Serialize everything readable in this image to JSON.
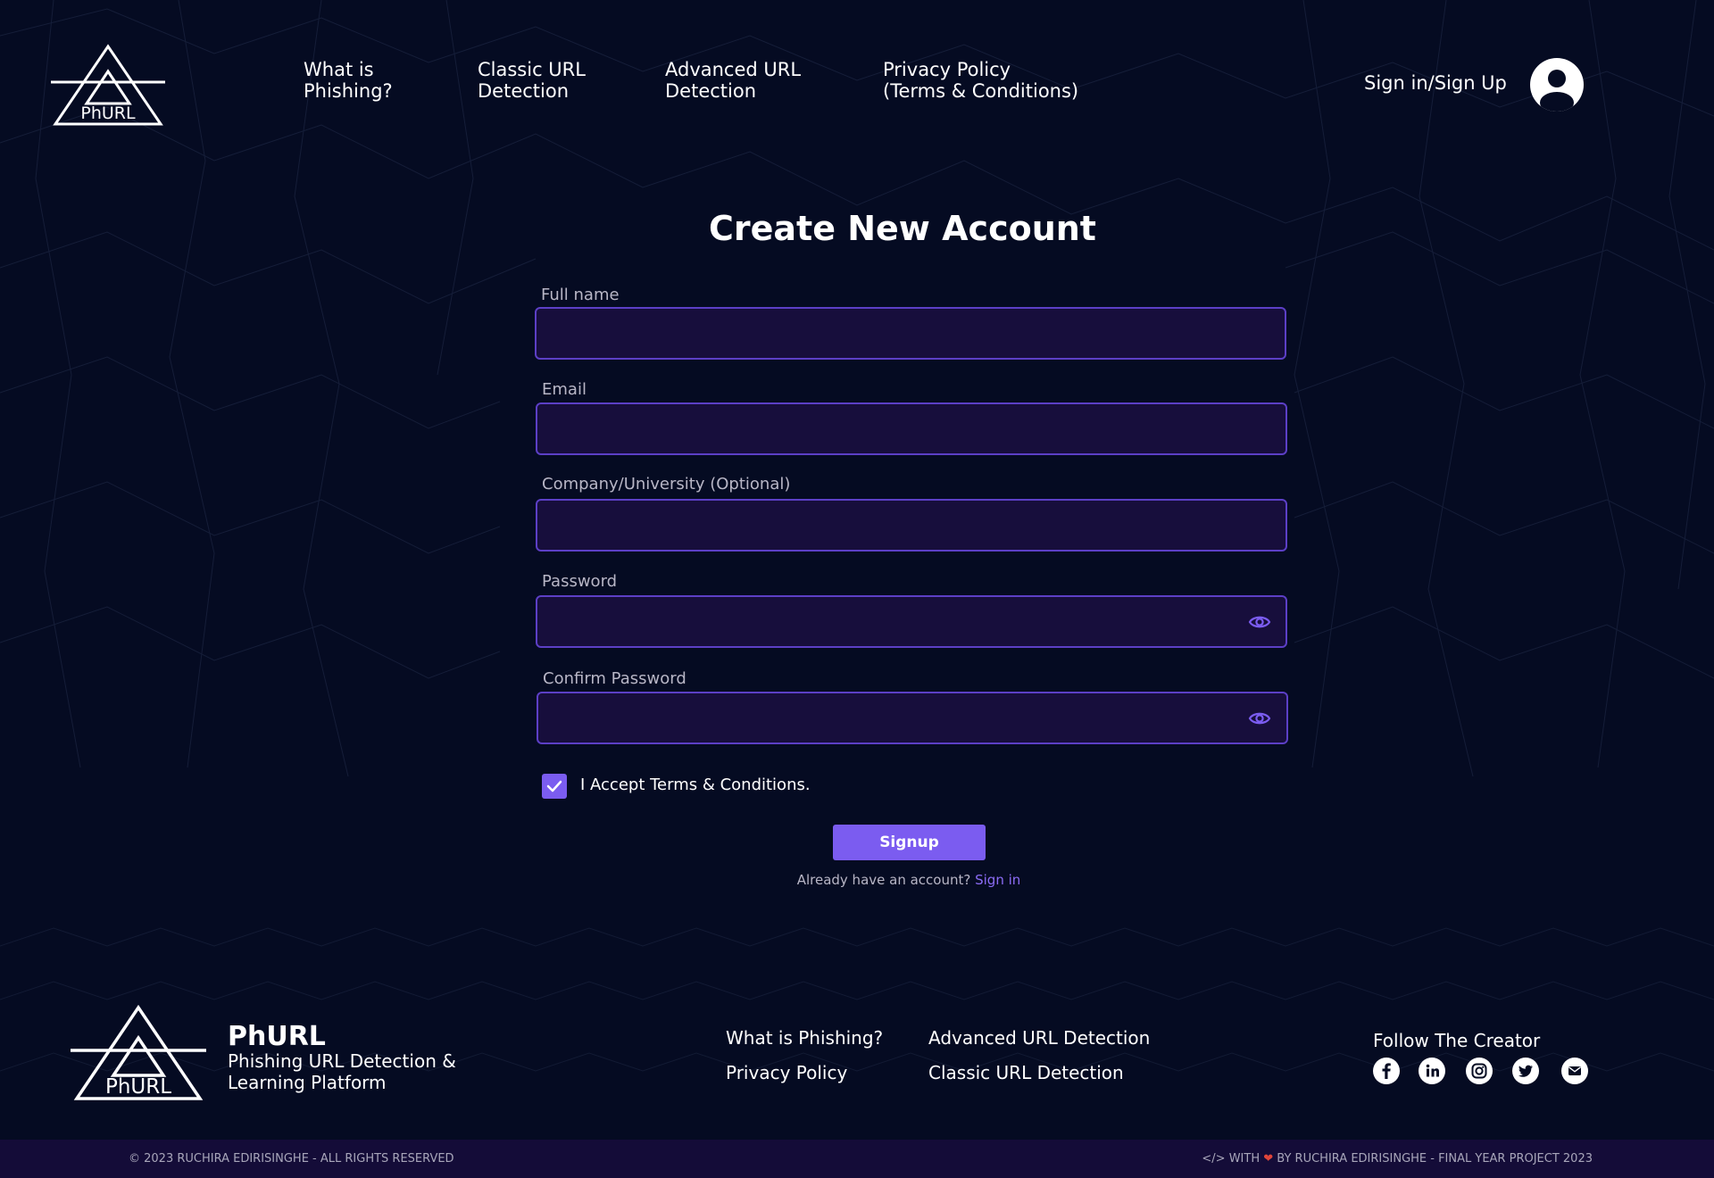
{
  "brand": {
    "logo_text": "PhURL",
    "name": "PhURL",
    "tagline": "Phishing URL Detection &\nLearning Platform"
  },
  "nav": {
    "items": [
      {
        "label": "What is\nPhishing?"
      },
      {
        "label": "Classic URL\nDetection"
      },
      {
        "label": "Advanced URL\nDetection"
      },
      {
        "label": "Privacy Policy\n(Terms & Conditions)"
      }
    ],
    "signin_label": "Sign in/Sign Up",
    "avatar_icon": "user-circle-icon"
  },
  "form": {
    "title": "Create New Account",
    "fields": [
      {
        "label": "Full name",
        "value": "",
        "placeholder": ""
      },
      {
        "label": "Email",
        "value": "",
        "placeholder": ""
      },
      {
        "label": "Company/University (Optional)",
        "value": "",
        "placeholder": ""
      },
      {
        "label": "Password",
        "value": "",
        "placeholder": "",
        "icon": "eye-icon"
      },
      {
        "label": "Confirm Password",
        "value": "",
        "placeholder": "",
        "icon": "eye-icon"
      }
    ],
    "terms_checked": true,
    "terms_label": "I Accept Terms & Conditions.",
    "submit_label": "Signup",
    "already_text": "Already have an account?",
    "signin_link": "Sign in"
  },
  "footer": {
    "links": [
      "What is Phishing?",
      "Advanced URL Detection",
      "Privacy Policy",
      "Classic URL Detection"
    ],
    "follow_title": "Follow The Creator",
    "socials": [
      "facebook-icon",
      "linkedin-icon",
      "instagram-icon",
      "twitter-icon",
      "mail-icon"
    ],
    "copyright": "© 2023 RUCHIRA EDIRISINGHE - ALL RIGHTS RESERVED",
    "credit_prefix": "</> WITH",
    "credit_suffix": "BY RUCHIRA EDIRISINGHE - FINAL YEAR PROJECT 2023"
  },
  "colors": {
    "background": "#050b22",
    "input_bg": "#170e3c",
    "input_border": "#5c3fc6",
    "accent": "#7b5cf0",
    "bottom_bar": "#140c38"
  }
}
